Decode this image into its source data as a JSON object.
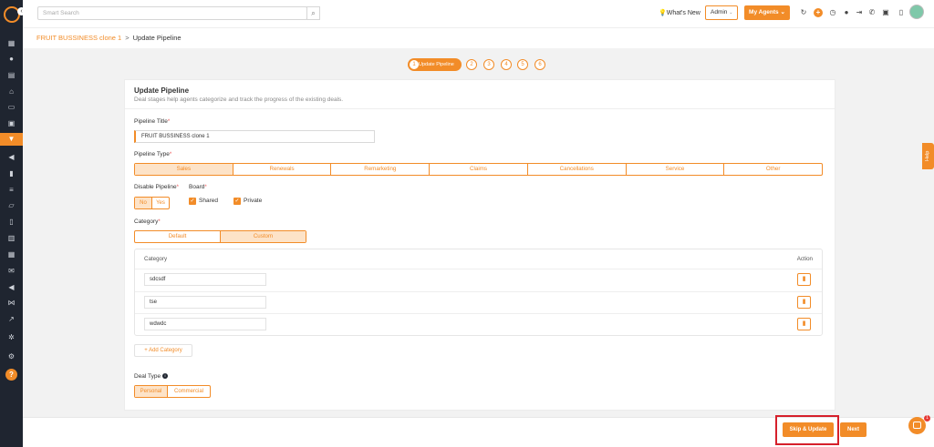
{
  "topbar": {
    "search_placeholder": "Smart Search",
    "whats_new": "What's New",
    "admin": "Admin",
    "my_agents": "My Agents"
  },
  "breadcrumb": {
    "parent": "FRUIT BUSSINESS clone 1",
    "separator": ">",
    "current": "Update Pipeline"
  },
  "stepper": {
    "active_label": "Update Pipeline",
    "steps": [
      "1",
      "2",
      "3",
      "4",
      "5",
      "6"
    ]
  },
  "card": {
    "title": "Update Pipeline",
    "subtitle": "Deal stages help agents categorize and track the progress of the existing deals."
  },
  "form": {
    "pipeline_title_label": "Pipeline Title",
    "pipeline_title_value": "FRUIT BUSSINESS clone 1",
    "pipeline_type_label": "Pipeline Type",
    "pipeline_types": [
      "Sales",
      "Renewals",
      "Remarketing",
      "Claims",
      "Cancellations",
      "Service",
      "Other"
    ],
    "pipeline_type_selected": "Sales",
    "disable_pipeline_label": "Disable Pipeline",
    "no": "No",
    "yes": "Yes",
    "board_label": "Board",
    "shared": "Shared",
    "private": "Private",
    "category_label": "Category",
    "category_default": "Default",
    "category_custom": "Custom",
    "table_category_header": "Category",
    "table_action_header": "Action",
    "categories": [
      "sdcsdf",
      "tse",
      "wdwdc"
    ],
    "add_category": "+ Add Category",
    "deal_type_label": "Deal Type",
    "deal_personal": "Personal",
    "deal_commercial": "Commercial"
  },
  "footer": {
    "skip_update": "Skip & Update",
    "next": "Next"
  },
  "help_tab": "Help",
  "chat_badge": "1",
  "colors": {
    "accent": "#f28c28",
    "sidebar": "#1f2530",
    "highlight": "#d6202b"
  }
}
